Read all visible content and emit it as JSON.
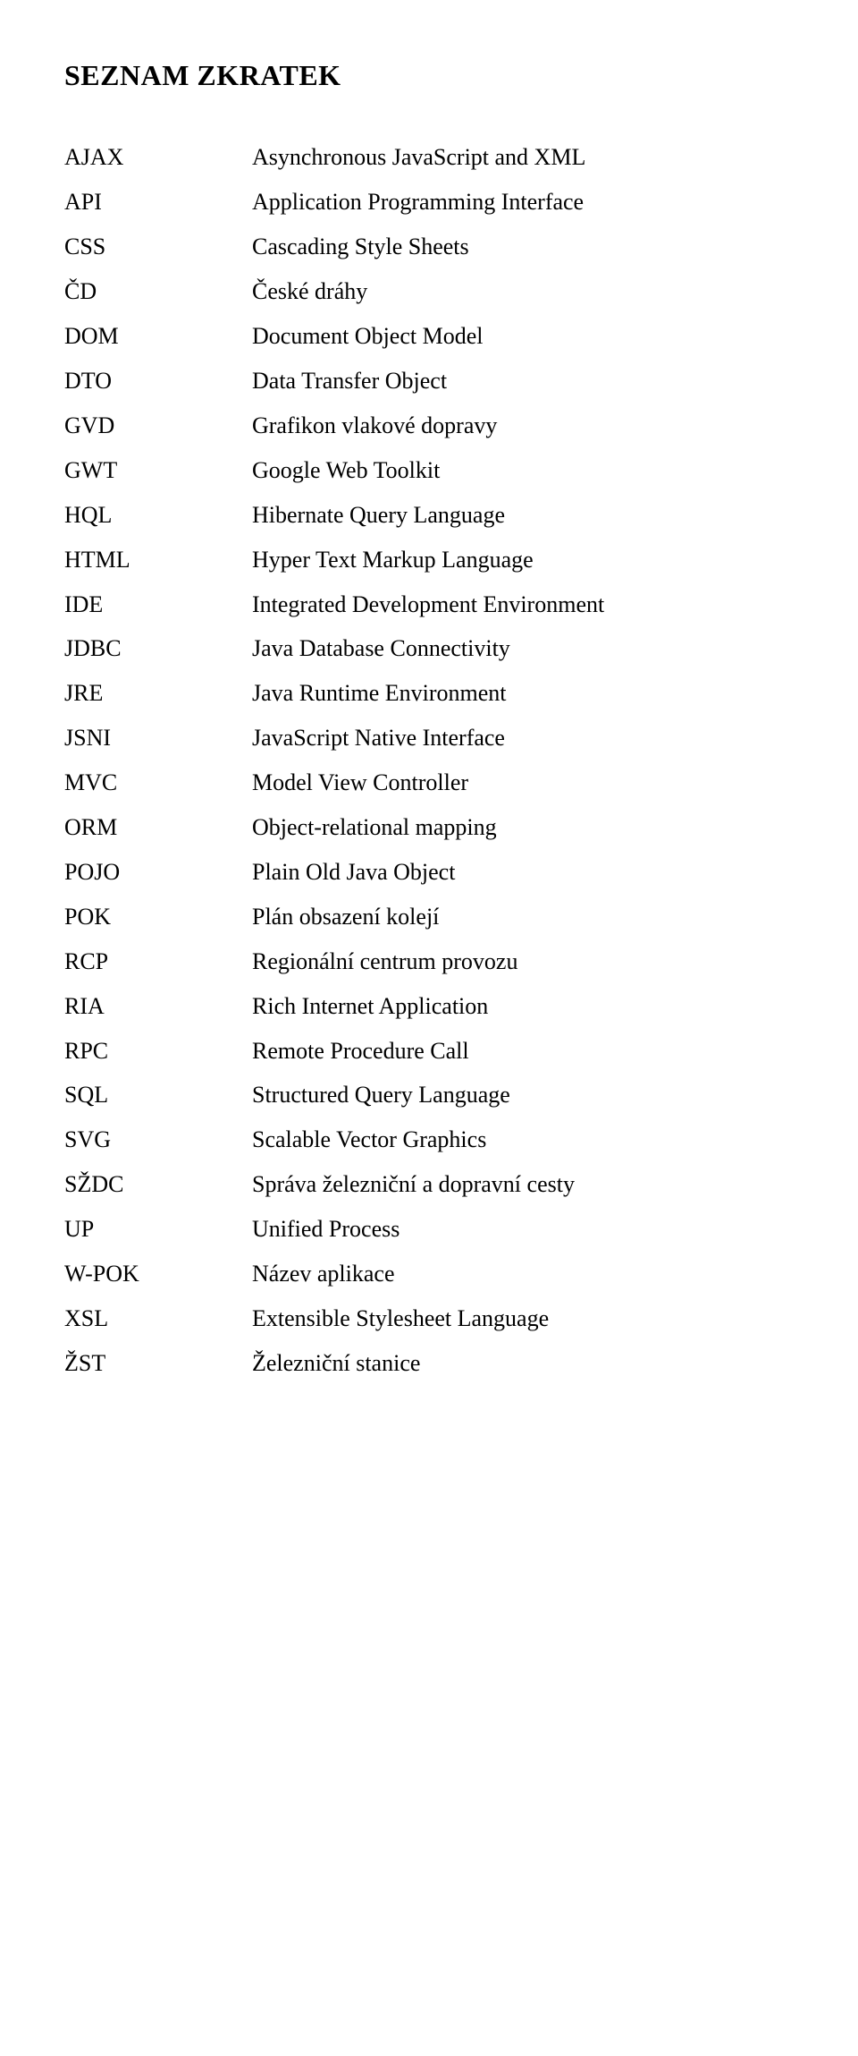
{
  "title": "SEZNAM ZKRATEK",
  "entries": [
    {
      "abbr": "AJAX",
      "def": "Asynchronous JavaScript and XML"
    },
    {
      "abbr": "API",
      "def": "Application Programming Interface"
    },
    {
      "abbr": "CSS",
      "def": "Cascading Style Sheets"
    },
    {
      "abbr": "ČD",
      "def": "České dráhy"
    },
    {
      "abbr": "DOM",
      "def": "Document Object Model"
    },
    {
      "abbr": "DTO",
      "def": "Data Transfer Object"
    },
    {
      "abbr": "GVD",
      "def": "Grafikon vlakové dopravy"
    },
    {
      "abbr": "GWT",
      "def": "Google Web Toolkit"
    },
    {
      "abbr": "HQL",
      "def": "Hibernate Query Language"
    },
    {
      "abbr": "HTML",
      "def": "Hyper Text Markup Language"
    },
    {
      "abbr": "IDE",
      "def": "Integrated Development Environment"
    },
    {
      "abbr": "JDBC",
      "def": "Java Database Connectivity"
    },
    {
      "abbr": "JRE",
      "def": "Java Runtime Environment"
    },
    {
      "abbr": "JSNI",
      "def": "JavaScript Native Interface"
    },
    {
      "abbr": "MVC",
      "def": "Model View Controller"
    },
    {
      "abbr": "ORM",
      "def": "Object-relational mapping"
    },
    {
      "abbr": "POJO",
      "def": "Plain Old Java Object"
    },
    {
      "abbr": "POK",
      "def": "Plán obsazení kolejí"
    },
    {
      "abbr": "RCP",
      "def": "Regionální centrum provozu"
    },
    {
      "abbr": "RIA",
      "def": "Rich Internet Application"
    },
    {
      "abbr": "RPC",
      "def": "Remote Procedure Call"
    },
    {
      "abbr": "SQL",
      "def": "Structured Query Language"
    },
    {
      "abbr": "SVG",
      "def": "Scalable Vector Graphics"
    },
    {
      "abbr": "SŽDC",
      "def": "Správa železniční a dopravní cesty"
    },
    {
      "abbr": "UP",
      "def": "Unified Process"
    },
    {
      "abbr": "W-POK",
      "def": "Název aplikace"
    },
    {
      "abbr": "XSL",
      "def": "Extensible Stylesheet Language"
    },
    {
      "abbr": "ŽST",
      "def": "Železniční stanice"
    }
  ]
}
